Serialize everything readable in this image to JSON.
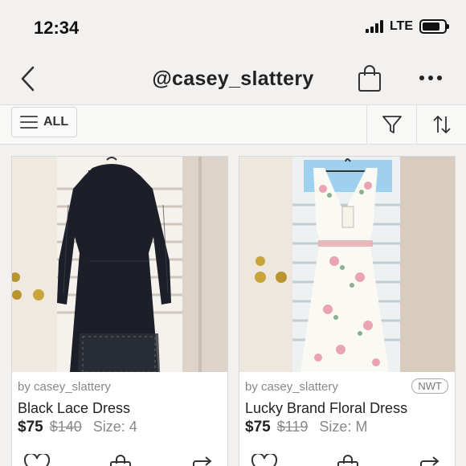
{
  "status_bar": {
    "time": "12:34",
    "network": "LTE",
    "battery_level": 0.8
  },
  "nav": {
    "title": "@casey_slattery",
    "icons": [
      "chevron-left-icon",
      "shopping-bag-icon",
      "more-dots-icon"
    ]
  },
  "filter_bar": {
    "all_label": "ALL",
    "icons": [
      "menu-icon",
      "filter-funnel-icon",
      "sort-arrows-icon"
    ]
  },
  "listings": [
    {
      "seller": "by casey_slattery",
      "title": "Black Lace Dress",
      "price": "$75",
      "original_price": "$140",
      "size": "Size: 4",
      "badge": ""
    },
    {
      "seller": "by casey_slattery",
      "title": "Lucky Brand Floral Dress",
      "price": "$75",
      "original_price": "$119",
      "size": "Size: M",
      "badge": "NWT"
    }
  ],
  "colors": {
    "background": "#f2f1f0",
    "card": "#ffffff",
    "text": "#222222",
    "muted": "#888888"
  }
}
